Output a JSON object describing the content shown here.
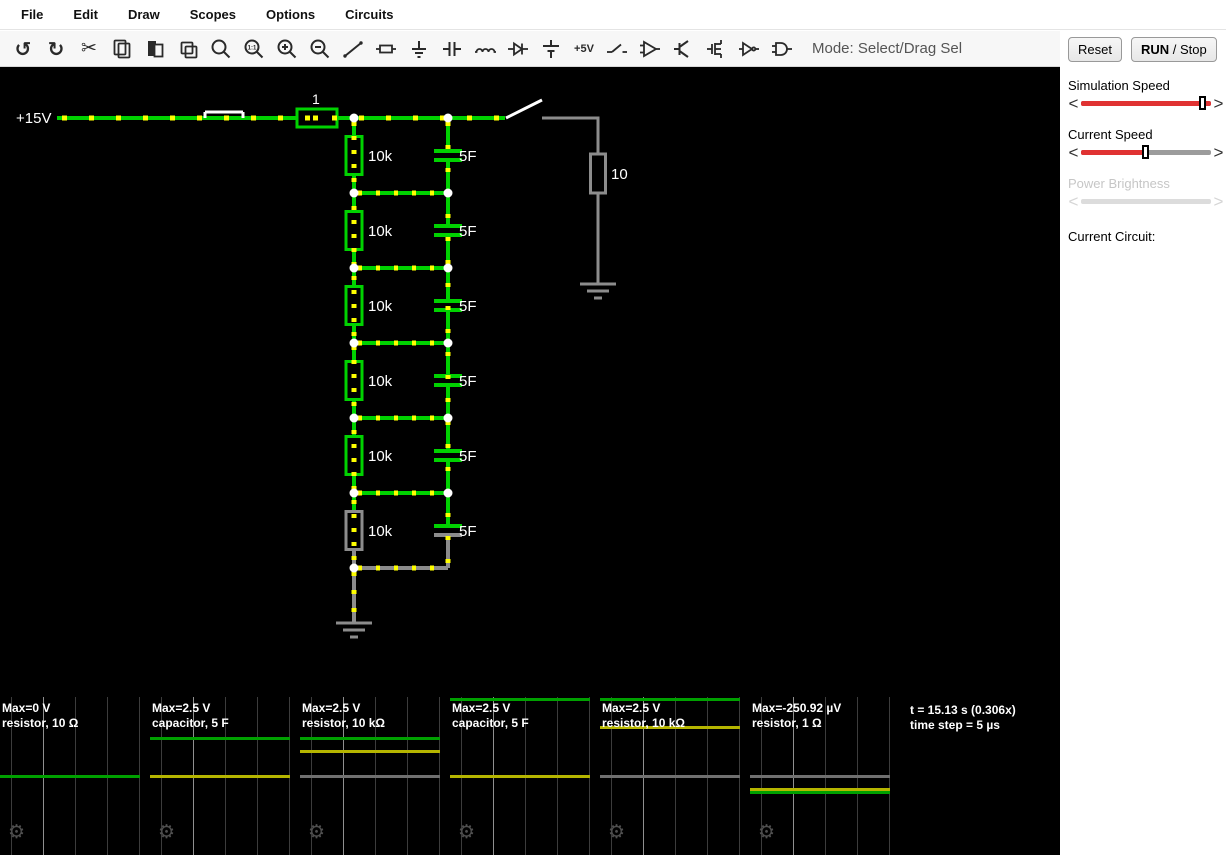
{
  "menu": {
    "items": [
      "File",
      "Edit",
      "Draw",
      "Scopes",
      "Options",
      "Circuits"
    ]
  },
  "toolbar": {
    "icons": [
      "undo",
      "redo",
      "cut",
      "copy",
      "paste",
      "duplicate",
      "zoom",
      "zoom-100",
      "zoom-in",
      "zoom-out",
      "wire",
      "resistor",
      "ground",
      "capacitor",
      "inductor",
      "diode",
      "voltage-source",
      "plus-5v",
      "switch",
      "op-amp",
      "transistor",
      "mosfet",
      "inverter",
      "and-gate"
    ],
    "plus5v_label": "+5V",
    "mode_label": "Mode: Select/Drag Sel"
  },
  "circuit": {
    "source_label": "+15V",
    "series_resistor_label": "1",
    "load_resistor_label": "10",
    "ladder_rows": [
      {
        "resistor": "10k",
        "capacitor": "5F"
      },
      {
        "resistor": "10k",
        "capacitor": "5F"
      },
      {
        "resistor": "10k",
        "capacitor": "5F"
      },
      {
        "resistor": "10k",
        "capacitor": "5F"
      },
      {
        "resistor": "10k",
        "capacitor": "5F"
      },
      {
        "resistor": "10k",
        "capacitor": "5F"
      }
    ]
  },
  "scopes": [
    {
      "max": "Max=0 V",
      "component": "resistor, 10 Ω",
      "traces": [
        {
          "color": "scope_green",
          "y": 78
        }
      ]
    },
    {
      "max": "Max=2.5 V",
      "component": "capacitor, 5 F",
      "traces": [
        {
          "color": "scope_green",
          "y": 40
        },
        {
          "color": "scope_yellow",
          "y": 78
        }
      ]
    },
    {
      "max": "Max=2.5 V",
      "component": "resistor, 10 kΩ",
      "traces": [
        {
          "color": "scope_green",
          "y": 40
        },
        {
          "color": "scope_yellow",
          "y": 53
        },
        {
          "color": "scope_gray",
          "y": 78
        }
      ]
    },
    {
      "max": "Max=2.5 V",
      "component": "capacitor, 5 F",
      "traces": [
        {
          "color": "scope_green",
          "y": 1
        },
        {
          "color": "scope_yellow",
          "y": 78
        }
      ]
    },
    {
      "max": "Max=2.5 V",
      "component": "resistor, 10 kΩ",
      "traces": [
        {
          "color": "scope_green",
          "y": 1
        },
        {
          "color": "scope_yellow",
          "y": 29
        },
        {
          "color": "scope_gray",
          "y": 78
        }
      ]
    },
    {
      "max": "Max=-250.92 µV",
      "component": "resistor, 1 Ω",
      "traces": [
        {
          "color": "scope_gray",
          "y": 78
        },
        {
          "color": "scope_yellow",
          "y": 91
        },
        {
          "color": "scope_green",
          "y": 94
        }
      ]
    }
  ],
  "status": {
    "time": "t = 15.13 s (0.306x)",
    "time_step": "time step = 5 µs"
  },
  "sidebar": {
    "reset_label": "Reset",
    "run_label": "RUN",
    "run_suffix": " / Stop",
    "sliders": [
      {
        "label": "Simulation Speed",
        "fill_pct": 100,
        "thumb_pct": 91,
        "disabled": false
      },
      {
        "label": "Current Speed",
        "fill_pct": 48,
        "thumb_pct": 47,
        "disabled": false
      },
      {
        "label": "Power Brightness",
        "fill_pct": 0,
        "thumb_pct": 0,
        "disabled": true
      }
    ],
    "current_circuit_label": "Current Circuit:"
  },
  "colors": {
    "wire_green": "#00d200",
    "current_yellow": "#ffff00",
    "neutral_gray": "#8c8c8c",
    "scope_green": "#00a000",
    "scope_yellow": "#b5b500",
    "scope_gray": "#707070",
    "slider_red": "#e03232"
  }
}
